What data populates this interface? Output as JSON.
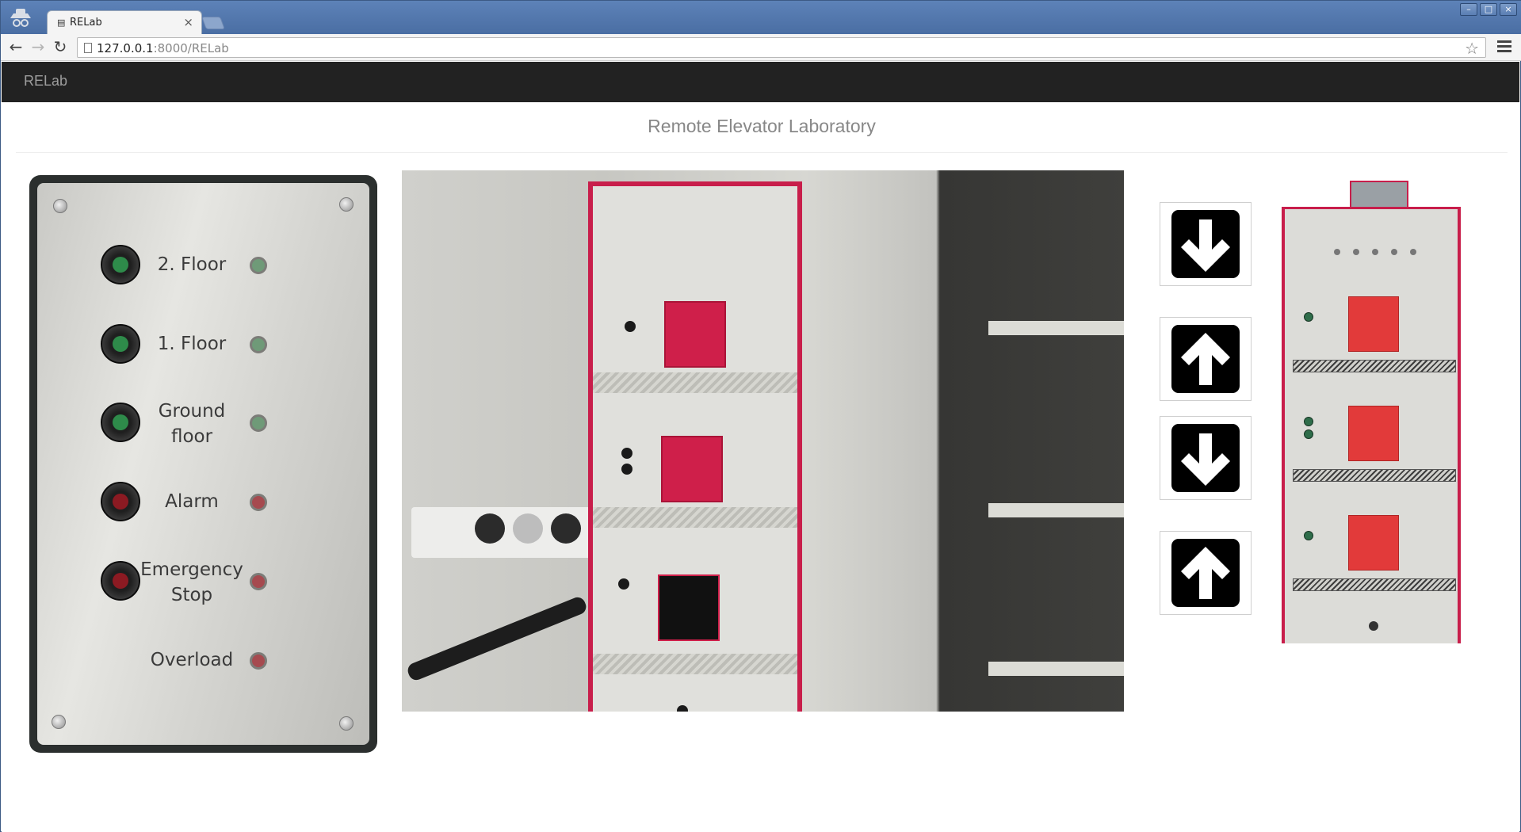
{
  "browser": {
    "tab_title": "RELab",
    "tab_close": "×",
    "url_host": "127.0.0.1",
    "url_rest": ":8000/RELab",
    "window_buttons": [
      "–",
      "□",
      "×"
    ],
    "icons": {
      "back": "←",
      "forward": "→",
      "reload": "↻",
      "star": "☆"
    }
  },
  "navbar": {
    "brand": "RELab"
  },
  "header": {
    "title": "Remote Elevator Laboratory"
  },
  "control_panel": {
    "rows": [
      {
        "label": "2. Floor",
        "button_color": "#2e8b4a",
        "led_color": "#6f9a78"
      },
      {
        "label": "1. Floor",
        "button_color": "#2e8b4a",
        "led_color": "#6f9a78"
      },
      {
        "label": "Ground floor",
        "button_color": "#2e8b4a",
        "led_color": "#6f9a78"
      },
      {
        "label": "Alarm",
        "button_color": "#8c1a22",
        "led_color": "#a64a4f"
      },
      {
        "label": "Emergency Stop",
        "button_color": "#8c1a22",
        "led_color": "#a64a4f"
      },
      {
        "label": "Overload",
        "button_color": null,
        "led_color": "#a64a4f"
      }
    ]
  },
  "call_buttons": [
    {
      "direction": "down",
      "icon": "arrow-down-icon"
    },
    {
      "direction": "up",
      "icon": "arrow-up-icon"
    },
    {
      "direction": "down",
      "icon": "arrow-down-icon"
    },
    {
      "direction": "up",
      "icon": "arrow-up-icon"
    }
  ],
  "colors": {
    "accent_red": "#c81e4b",
    "navbar_bg": "#222222",
    "brand_text": "#9d9d9d"
  }
}
